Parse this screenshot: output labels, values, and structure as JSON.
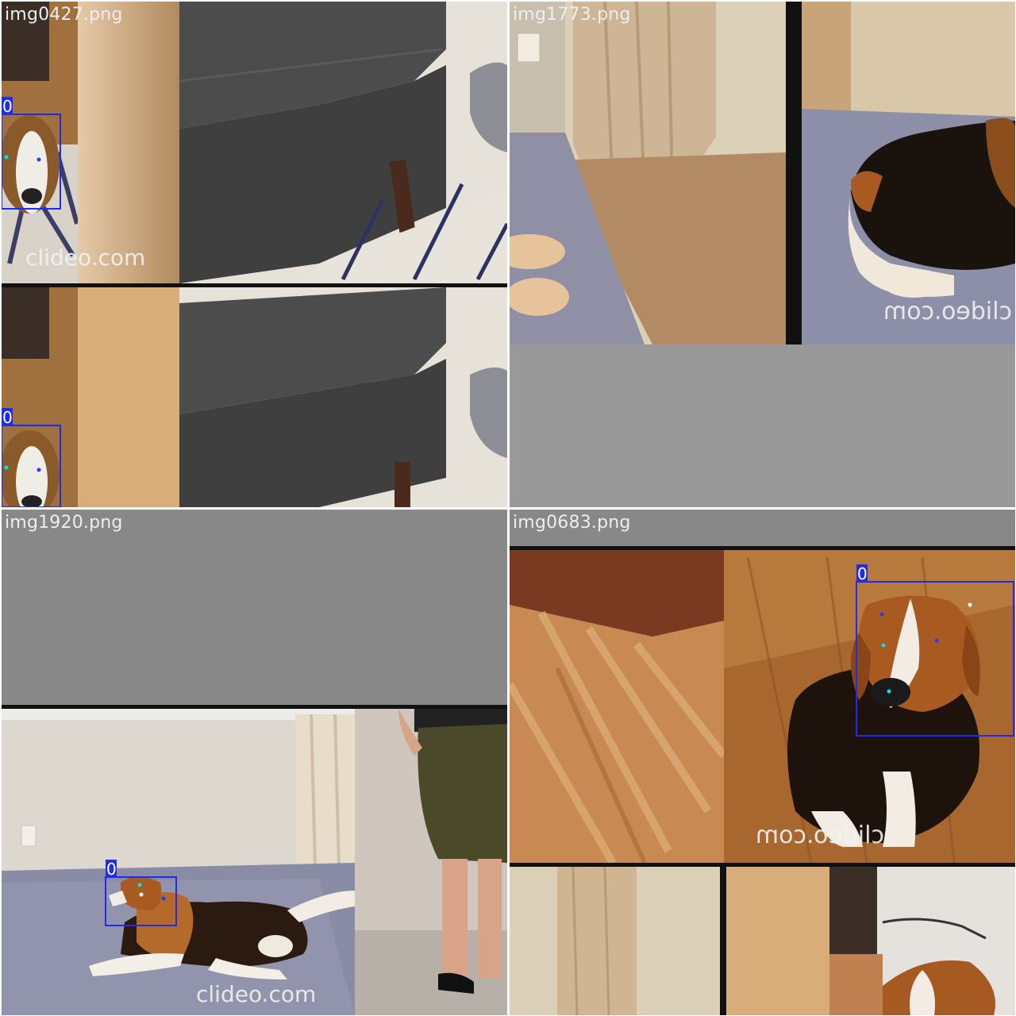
{
  "mosaic": {
    "tiles": [
      {
        "id": "tl",
        "filename": "img0427.png",
        "watermark": "clideo.com",
        "boxes": [
          {
            "label": "0"
          },
          {
            "label": "0"
          }
        ]
      },
      {
        "id": "tr",
        "filename": "img1773.png",
        "watermark": "clideo.com",
        "boxes": []
      },
      {
        "id": "bl",
        "filename": "img1920.png",
        "watermark": "clideo.com",
        "boxes": [
          {
            "label": "0"
          }
        ]
      },
      {
        "id": "br",
        "filename": "img0683.png",
        "watermark": "clideo.com",
        "boxes": [
          {
            "label": "0"
          }
        ]
      }
    ]
  },
  "colors": {
    "box": "#1f2ee6",
    "pad_gray": "#999999",
    "keypoint_cyan": "#00e5e5",
    "keypoint_blue": "#2040ff",
    "keypoint_white": "#ffffff"
  }
}
